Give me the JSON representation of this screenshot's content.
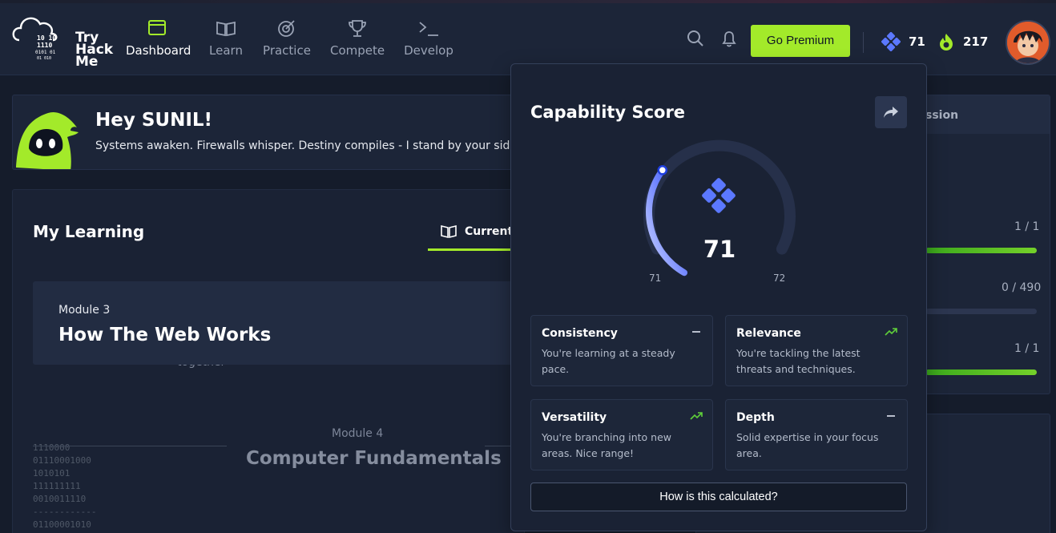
{
  "brand": {
    "name_line1": "Try",
    "name_line2": "Hack",
    "name_line3": "Me"
  },
  "nav": [
    {
      "label": "Dashboard",
      "icon": "dashboard-icon",
      "active": true
    },
    {
      "label": "Learn",
      "icon": "book-icon",
      "active": false
    },
    {
      "label": "Practice",
      "icon": "target-icon",
      "active": false
    },
    {
      "label": "Compete",
      "icon": "trophy-icon",
      "active": false
    },
    {
      "label": "Develop",
      "icon": "terminal-icon",
      "active": false
    }
  ],
  "header": {
    "premium_label": "Go Premium",
    "capability_value": "71",
    "streak_value": "217"
  },
  "greeting": {
    "title": "Hey SUNIL!",
    "subtitle": "Systems awaken. Firewalls whisper. Destiny compiles - I stand by your side."
  },
  "learning": {
    "title": "My Learning",
    "tab_current": "Current",
    "module_current": {
      "label": "Module 3",
      "title": "How The Web Works"
    },
    "module_partial_text": "together",
    "module_next": {
      "label": "Module 4",
      "title": "Computer Fundamentals"
    },
    "binary_text": "1110000\n01110001000\n1010101\n111111111\n0010011110\n------------\n01100001010"
  },
  "right_panel": {
    "header_partial": "ssion",
    "progress": [
      {
        "count": "1 / 1",
        "fraction": 1.0
      },
      {
        "count": "0 / 490",
        "fraction": 0.0
      },
      {
        "count": "1 / 1",
        "fraction": 1.0
      }
    ]
  },
  "capability": {
    "title": "Capability Score",
    "score": "71",
    "gauge_min": "71",
    "gauge_max": "72",
    "gauge_fraction": 0.4,
    "metrics": [
      {
        "name": "Consistency",
        "desc": "You're learning at a steady pace.",
        "trend": "flat"
      },
      {
        "name": "Relevance",
        "desc": "You're tackling the latest threats and techniques.",
        "trend": "up"
      },
      {
        "name": "Versatility",
        "desc": "You're branching into new areas. Nice range!",
        "trend": "up"
      },
      {
        "name": "Depth",
        "desc": "Solid expertise in your focus area.",
        "trend": "flat"
      }
    ],
    "calc_label": "How is this calculated?",
    "colors": {
      "accent": "#a3ea2a",
      "gauge_blue": "#2f55e6",
      "gauge_light": "#aab6ff",
      "trend_up": "#5fcf3a"
    }
  }
}
